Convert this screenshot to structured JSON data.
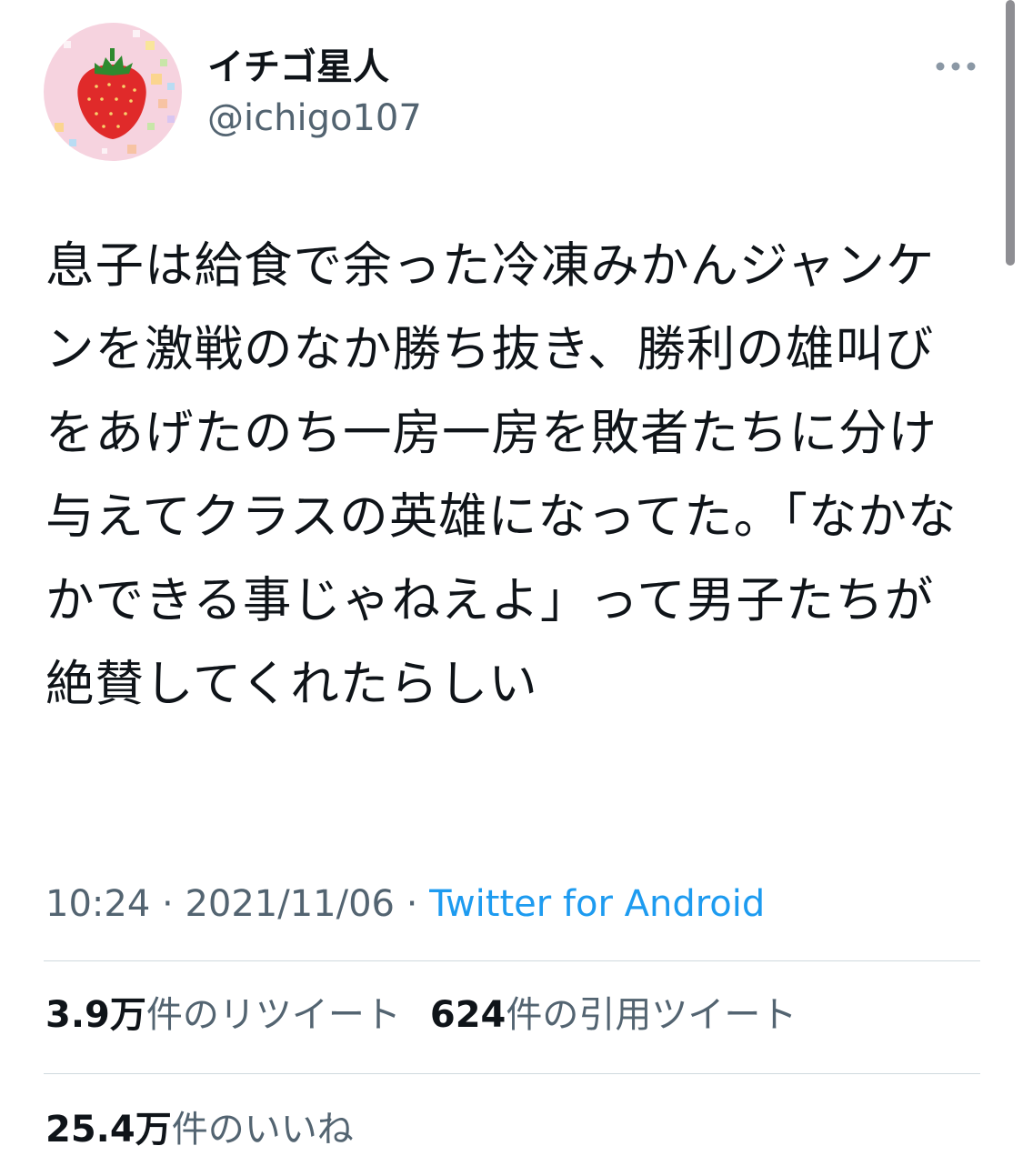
{
  "user": {
    "display_name": "イチゴ星人",
    "handle": "@ichigo107",
    "avatar_icon": "strawberry-icon"
  },
  "tweet": {
    "text": "息子は給食で余った冷凍みかんジャンケンを激戦のなか勝ち抜き、勝利の雄叫びをあげたのち一房一房を敗者たちに分け与えてクラスの英雄になってた。「なかなかできる事じゃねえよ」って男子たちが絶賛してくれたらしい",
    "time": "10:24",
    "separator": " · ",
    "date": "2021/11/06",
    "source": "Twitter for Android"
  },
  "stats": {
    "retweets": {
      "count": "3.9万",
      "label": "件のリツイート"
    },
    "quotes": {
      "count": "624",
      "label": "件の引用ツイート"
    },
    "likes": {
      "count": "25.4万",
      "label": "件のいいね"
    }
  },
  "colors": {
    "text_primary": "#0f1419",
    "text_secondary": "#536471",
    "link": "#1d9bf0",
    "divider": "#cfd9de"
  }
}
